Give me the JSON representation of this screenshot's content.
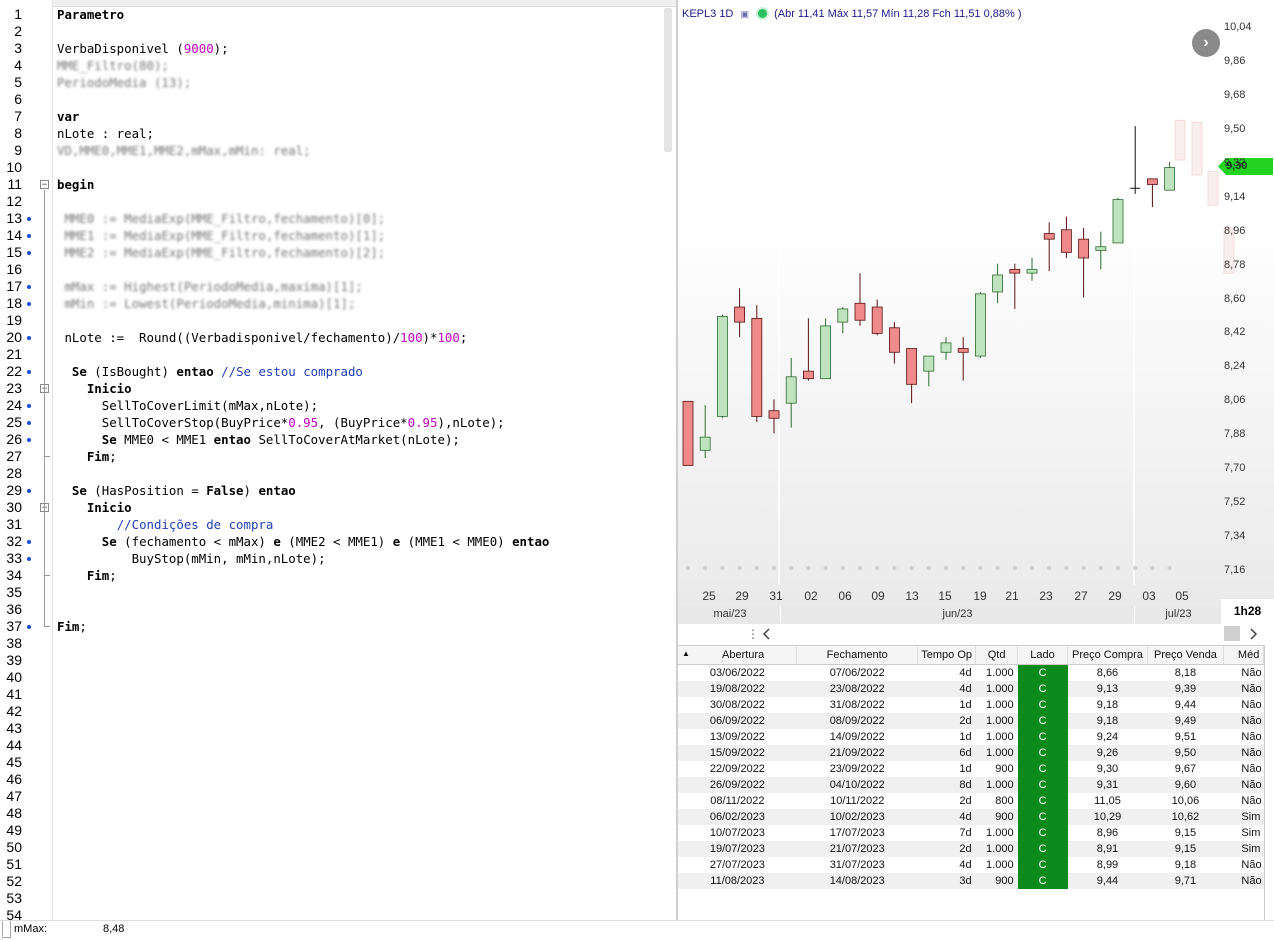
{
  "editor": {
    "lines": [
      {
        "n": "1",
        "html": "<span class='kw'>Parametro</span>"
      },
      {
        "n": "2",
        "html": ""
      },
      {
        "n": "3",
        "html": "VerbaDisponivel (<span class='num'>9000</span>);"
      },
      {
        "n": "4",
        "html": "<span class='blur'>MME_Filtro(80);</span>"
      },
      {
        "n": "5",
        "html": "<span class='blur'>PeriodoMedia (13);</span>"
      },
      {
        "n": "6",
        "html": ""
      },
      {
        "n": "7",
        "html": "<span class='kw'>var</span>"
      },
      {
        "n": "8",
        "html": "nLote : real;"
      },
      {
        "n": "9",
        "html": "<span class='blur'>VD,MME0,MME1,MME2,mMax,mMin: real;</span>"
      },
      {
        "n": "10",
        "html": ""
      },
      {
        "n": "11",
        "html": "<span class='kw'>begin</span>",
        "fold": "−"
      },
      {
        "n": "12",
        "html": ""
      },
      {
        "n": "13",
        "html": " <span class='blur'>MME0 := MediaExp(MME_Filtro,fechamento)[0];</span>",
        "bp": true
      },
      {
        "n": "14",
        "html": " <span class='blur'>MME1 := MediaExp(MME_Filtro,fechamento)[1];</span>",
        "bp": true
      },
      {
        "n": "15",
        "html": " <span class='blur'>MME2 := MediaExp(MME_Filtro,fechamento)[2];</span>",
        "bp": true
      },
      {
        "n": "16",
        "html": ""
      },
      {
        "n": "17",
        "html": " <span class='blur'>mMax := Highest(PeriodoMedia,maxima)[1];</span>",
        "bp": true
      },
      {
        "n": "18",
        "html": " <span class='blur'>mMin := Lowest(PeriodoMedia,minima)[1];</span>",
        "bp": true
      },
      {
        "n": "19",
        "html": ""
      },
      {
        "n": "20",
        "html": " nLote :=  Round((Verbadisponivel/fechamento)/<span class='num'>100</span>)*<span class='num'>100</span>;",
        "bp": true
      },
      {
        "n": "21",
        "html": ""
      },
      {
        "n": "22",
        "html": "  <span class='kw'>Se</span> (IsBought) <span class='kw'>entao</span> <span class='cm'>//Se estou comprado</span>",
        "bp": true
      },
      {
        "n": "23",
        "html": "    <span class='kw'>Inicio</span>",
        "fold": "−"
      },
      {
        "n": "24",
        "html": "      SellToCoverLimit(mMax,nLote);",
        "bp": true
      },
      {
        "n": "25",
        "html": "      SellToCoverStop(BuyPrice*<span class='num'>0.95</span>, (BuyPrice*<span class='num'>0.95</span>),nLote);",
        "bp": true
      },
      {
        "n": "26",
        "html": "      <span class='kw'>Se</span> MME0 &lt; MME1 <span class='kw'>entao</span> SellToCoverAtMarket(nLote);",
        "bp": true
      },
      {
        "n": "27",
        "html": "    <span class='kw'>Fim</span>;"
      },
      {
        "n": "28",
        "html": ""
      },
      {
        "n": "29",
        "html": "  <span class='kw'>Se</span> (HasPosition = <span class='kw'>False</span>) <span class='kw'>entao</span>",
        "bp": true
      },
      {
        "n": "30",
        "html": "    <span class='kw'>Inicio</span>",
        "fold": "−"
      },
      {
        "n": "31",
        "html": "        <span class='cm'>//Condições de compra</span>"
      },
      {
        "n": "32",
        "html": "      <span class='kw'>Se</span> (fechamento &lt; mMax) <span class='kw'>e</span> (MME2 &lt; MME1) <span class='kw'>e</span> (MME1 &lt; MME0) <span class='kw'>entao</span>",
        "bp": true
      },
      {
        "n": "33",
        "html": "          BuyStop(mMin, mMin,nLote);",
        "bp": true
      },
      {
        "n": "34",
        "html": "    <span class='kw'>Fim</span>;"
      },
      {
        "n": "35",
        "html": ""
      },
      {
        "n": "36",
        "html": ""
      },
      {
        "n": "37",
        "html": "<span class='kw'>Fim</span>;",
        "bp": true
      },
      {
        "n": "38",
        "html": ""
      },
      {
        "n": "39",
        "html": ""
      },
      {
        "n": "40",
        "html": ""
      },
      {
        "n": "41",
        "html": ""
      },
      {
        "n": "42",
        "html": ""
      },
      {
        "n": "43",
        "html": ""
      },
      {
        "n": "44",
        "html": ""
      },
      {
        "n": "45",
        "html": ""
      },
      {
        "n": "46",
        "html": ""
      },
      {
        "n": "47",
        "html": ""
      },
      {
        "n": "48",
        "html": ""
      },
      {
        "n": "49",
        "html": ""
      },
      {
        "n": "50",
        "html": ""
      },
      {
        "n": "51",
        "html": ""
      },
      {
        "n": "52",
        "html": ""
      },
      {
        "n": "53",
        "html": ""
      },
      {
        "n": "54",
        "html": ""
      }
    ]
  },
  "chart": {
    "symbol": "KEPL3",
    "timeframe": "1D",
    "mini_icon": "▣",
    "quote": "(Abr 11,41 Máx 11,57 Mín 11,28 Fch 11,51 0,88% )",
    "next_symbol": "›",
    "last_price": "9,30",
    "interval": "1h28",
    "y_ticks": [
      "10,04",
      "9,86",
      "9,68",
      "9,50",
      "9,32",
      "9,14",
      "8,96",
      "8,78",
      "8,60",
      "8,42",
      "8,24",
      "8,06",
      "7,88",
      "7,70",
      "7,52",
      "7,34",
      "7,16"
    ],
    "x_ticks": [
      "25",
      "29",
      "31",
      "02",
      "06",
      "09",
      "13",
      "15",
      "19",
      "21",
      "23",
      "27",
      "29",
      "03",
      "05"
    ],
    "months": [
      "mai/23",
      "jun/23",
      "jul/23"
    ],
    "colors": {
      "up": "#bfe3bf",
      "down": "#f08a8a",
      "badge": "#22d322",
      "trade_side": "#0d8a1c"
    }
  },
  "chart_data": {
    "type": "candlestick",
    "ylim": [
      7.16,
      10.04
    ],
    "candles": [
      {
        "o": 8.06,
        "h": 8.06,
        "l": 7.72,
        "c": 7.72,
        "dir": "down"
      },
      {
        "o": 7.8,
        "h": 8.04,
        "l": 7.76,
        "c": 7.87,
        "dir": "up"
      },
      {
        "o": 7.98,
        "h": 8.52,
        "l": 7.97,
        "c": 8.51,
        "dir": "up"
      },
      {
        "o": 8.56,
        "h": 8.66,
        "l": 8.4,
        "c": 8.48,
        "dir": "down"
      },
      {
        "o": 8.5,
        "h": 8.57,
        "l": 7.95,
        "c": 7.98,
        "dir": "down"
      },
      {
        "o": 8.01,
        "h": 8.07,
        "l": 7.89,
        "c": 7.97,
        "dir": "down"
      },
      {
        "o": 8.05,
        "h": 8.29,
        "l": 7.92,
        "c": 8.19,
        "dir": "up"
      },
      {
        "o": 8.22,
        "h": 8.5,
        "l": 8.17,
        "c": 8.18,
        "dir": "down"
      },
      {
        "o": 8.18,
        "h": 8.5,
        "l": 8.18,
        "c": 8.46,
        "dir": "up"
      },
      {
        "o": 8.48,
        "h": 8.56,
        "l": 8.42,
        "c": 8.55,
        "dir": "up"
      },
      {
        "o": 8.58,
        "h": 8.74,
        "l": 8.46,
        "c": 8.49,
        "dir": "down"
      },
      {
        "o": 8.56,
        "h": 8.6,
        "l": 8.41,
        "c": 8.42,
        "dir": "down"
      },
      {
        "o": 8.45,
        "h": 8.48,
        "l": 8.26,
        "c": 8.32,
        "dir": "down"
      },
      {
        "o": 8.34,
        "h": 8.34,
        "l": 8.05,
        "c": 8.15,
        "dir": "down"
      },
      {
        "o": 8.22,
        "h": 8.28,
        "l": 8.14,
        "c": 8.3,
        "dir": "up"
      },
      {
        "o": 8.32,
        "h": 8.4,
        "l": 8.28,
        "c": 8.37,
        "dir": "up"
      },
      {
        "o": 8.34,
        "h": 8.4,
        "l": 8.17,
        "c": 8.32,
        "dir": "down"
      },
      {
        "o": 8.3,
        "h": 8.64,
        "l": 8.29,
        "c": 8.63,
        "dir": "up"
      },
      {
        "o": 8.64,
        "h": 8.79,
        "l": 8.58,
        "c": 8.73,
        "dir": "up"
      },
      {
        "o": 8.76,
        "h": 8.79,
        "l": 8.55,
        "c": 8.74,
        "dir": "down"
      },
      {
        "o": 8.74,
        "h": 8.82,
        "l": 8.7,
        "c": 8.76,
        "dir": "up"
      },
      {
        "o": 8.95,
        "h": 9.01,
        "l": 8.75,
        "c": 8.92,
        "dir": "down"
      },
      {
        "o": 8.97,
        "h": 9.04,
        "l": 8.82,
        "c": 8.85,
        "dir": "down"
      },
      {
        "o": 8.92,
        "h": 8.98,
        "l": 8.61,
        "c": 8.82,
        "dir": "down"
      },
      {
        "o": 8.86,
        "h": 8.96,
        "l": 8.76,
        "c": 8.88,
        "dir": "up"
      },
      {
        "o": 8.9,
        "h": 9.14,
        "l": 8.9,
        "c": 9.13,
        "dir": "up"
      },
      {
        "o": 9.2,
        "h": 9.52,
        "l": 9.16,
        "c": 9.19,
        "dir": "flat"
      },
      {
        "o": 9.24,
        "h": 9.24,
        "l": 9.09,
        "c": 9.21,
        "dir": "down"
      },
      {
        "o": 9.18,
        "h": 9.33,
        "l": 9.18,
        "c": 9.3,
        "dir": "up"
      }
    ]
  },
  "trades": {
    "columns": [
      "Abertura",
      "Fechamento",
      "Tempo Op",
      "Qtd",
      "Lado",
      "Preço Compra",
      "Preço Venda",
      "Méd"
    ],
    "rows": [
      [
        "03/06/2022",
        "07/06/2022",
        "4d",
        "1.000",
        "C",
        "8,66",
        "8,18",
        "Não"
      ],
      [
        "19/08/2022",
        "23/08/2022",
        "4d",
        "1.000",
        "C",
        "9,13",
        "9,39",
        "Não"
      ],
      [
        "30/08/2022",
        "31/08/2022",
        "1d",
        "1.000",
        "C",
        "9,18",
        "9,44",
        "Não"
      ],
      [
        "06/09/2022",
        "08/09/2022",
        "2d",
        "1.000",
        "C",
        "9,18",
        "9,49",
        "Não"
      ],
      [
        "13/09/2022",
        "14/09/2022",
        "1d",
        "1.000",
        "C",
        "9,24",
        "9,51",
        "Não"
      ],
      [
        "15/09/2022",
        "21/09/2022",
        "6d",
        "1.000",
        "C",
        "9,26",
        "9,50",
        "Não"
      ],
      [
        "22/09/2022",
        "23/09/2022",
        "1d",
        "900",
        "C",
        "9,30",
        "9,67",
        "Não"
      ],
      [
        "26/09/2022",
        "04/10/2022",
        "8d",
        "1.000",
        "C",
        "9,31",
        "9,60",
        "Não"
      ],
      [
        "08/11/2022",
        "10/11/2022",
        "2d",
        "800",
        "C",
        "11,05",
        "10,06",
        "Não"
      ],
      [
        "06/02/2023",
        "10/02/2023",
        "4d",
        "900",
        "C",
        "10,29",
        "10,62",
        "Sim"
      ],
      [
        "10/07/2023",
        "17/07/2023",
        "7d",
        "1.000",
        "C",
        "8,96",
        "9,15",
        "Sim"
      ],
      [
        "19/07/2023",
        "21/07/2023",
        "2d",
        "1.000",
        "C",
        "8,91",
        "9,15",
        "Sim"
      ],
      [
        "27/07/2023",
        "31/07/2023",
        "4d",
        "1.000",
        "C",
        "8,99",
        "9,18",
        "Não"
      ],
      [
        "11/08/2023",
        "14/08/2023",
        "3d",
        "900",
        "C",
        "9,44",
        "9,71",
        "Não"
      ]
    ]
  },
  "status": {
    "label": "mMax:",
    "value": "8,48"
  }
}
